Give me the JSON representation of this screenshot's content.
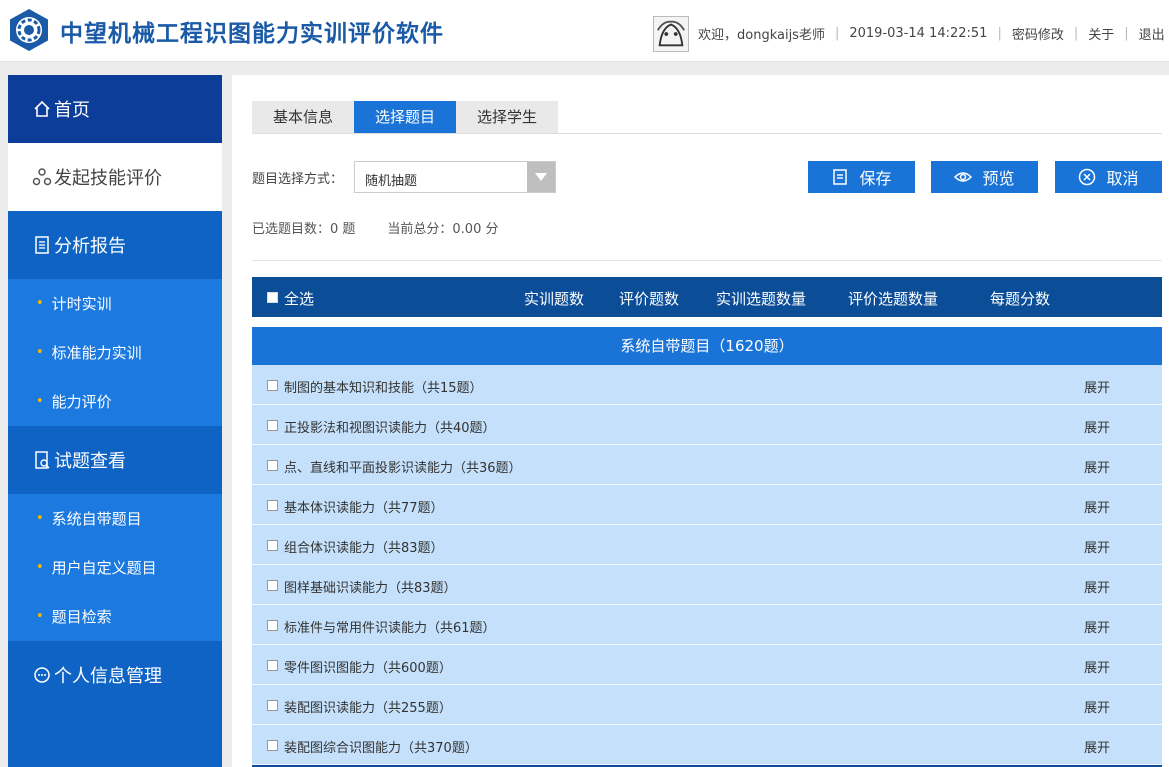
{
  "header": {
    "app_title": "中望机械工程识图能力实训评价软件",
    "welcome": "欢迎，dongkaijs老师",
    "datetime": "2019-03-14 14:22:51",
    "change_password": "密码修改",
    "about": "关于",
    "logout": "退出"
  },
  "sidebar": {
    "home": "首页",
    "launch_eval": "发起技能评价",
    "report": "分析报告",
    "report_items": [
      "计时实训",
      "标准能力实训",
      "能力评价"
    ],
    "question_view": "试题查看",
    "question_items": [
      "系统自带题目",
      "用户自定义题目",
      "题目检索"
    ],
    "personal": "个人信息管理"
  },
  "tabs": [
    "基本信息",
    "选择题目",
    "选择学生"
  ],
  "selector": {
    "label": "题目选择方式：",
    "value": "随机抽题"
  },
  "buttons": {
    "save": "保存",
    "preview": "预览",
    "cancel": "取消"
  },
  "stats": {
    "selected": "已选题目数：0 题",
    "total": "当前总分：0.00 分"
  },
  "table": {
    "select_all": "全选",
    "columns": [
      "实训题数",
      "评价题数",
      "实训选题数量",
      "评价选题数量",
      "每题分数"
    ],
    "group_title": "系统自带题目（1620题）",
    "expand_label": "展开",
    "rows": [
      "制图的基本知识和技能（共15题）",
      "正投影法和视图识读能力（共40题）",
      "点、直线和平面投影识读能力（共36题）",
      "基本体识读能力（共77题）",
      "组合体识读能力（共83题）",
      "图样基础识读能力（共83题）",
      "标准件与常用件识读能力（共61题）",
      "零件图识图能力（共600题）",
      "装配图识读能力（共255题）",
      "装配图综合识图能力（共370题）"
    ]
  },
  "colors": {
    "brand": "#1a5aa6",
    "sidebar": "#0e63c4",
    "sidebar_dark": "#0b3d99",
    "accent": "#1a74d8",
    "table_header": "#0b4d96",
    "row_bg": "#c4e0fa"
  }
}
